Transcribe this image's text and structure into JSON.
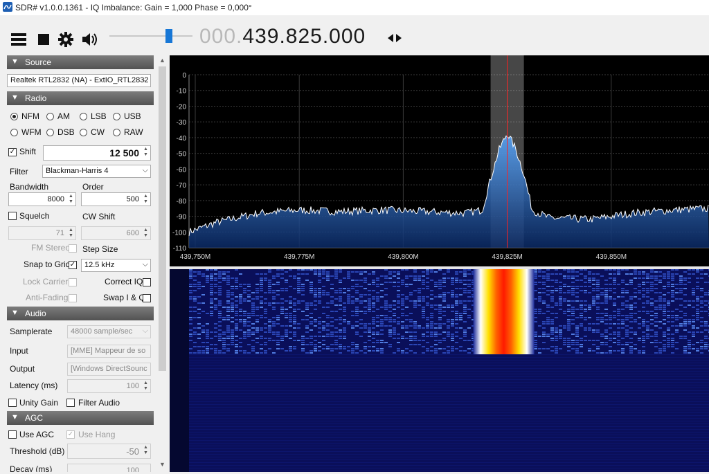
{
  "title": "SDR# v1.0.0.1361 - IQ Imbalance: Gain = 1,000 Phase = 0,000°",
  "toolbar": {
    "freq_lead": "000.",
    "freq_main": "439.825.000",
    "volume_level": 0.7
  },
  "source": {
    "header": "Source",
    "device": "Realtek RTL2832 (NA) - ExtIO_RTL2832"
  },
  "radio": {
    "header": "Radio",
    "modes_row1": [
      "NFM",
      "AM",
      "LSB",
      "USB"
    ],
    "modes_row2": [
      "WFM",
      "DSB",
      "CW",
      "RAW"
    ],
    "selected_mode": "NFM",
    "shift_label": "Shift",
    "shift_value": "12 500",
    "filter_label": "Filter",
    "filter_value": "Blackman-Harris 4",
    "bandwidth_label": "Bandwidth",
    "bandwidth_value": "8000",
    "order_label": "Order",
    "order_value": "500",
    "squelch_label": "Squelch",
    "squelch_value": "71",
    "cwshift_label": "CW Shift",
    "cwshift_value": "600",
    "fmstereo_label": "FM Stereo",
    "stepsize_label": "Step Size",
    "snap_label": "Snap to Grid",
    "snap_value": "12.5 kHz",
    "lockcarrier_label": "Lock Carrier",
    "correctiq_label": "Correct IQ",
    "antifading_label": "Anti-Fading",
    "swapiq_label": "Swap I & Q"
  },
  "audio": {
    "header": "Audio",
    "samplerate_label": "Samplerate",
    "samplerate_value": "48000 sample/sec",
    "input_label": "Input",
    "input_value": "[MME] Mappeur de so",
    "output_label": "Output",
    "output_value": "[Windows DirectSounc",
    "latency_label": "Latency (ms)",
    "latency_value": "100",
    "unitygain_label": "Unity Gain",
    "filteraudio_label": "Filter Audio"
  },
  "agc": {
    "header": "AGC",
    "useagc_label": "Use AGC",
    "usehang_label": "Use Hang",
    "threshold_label": "Threshold (dB)",
    "threshold_value": "-50",
    "decay_label": "Decay (ms)",
    "decay_value": "100"
  },
  "colors": {
    "accent": "#1777d6",
    "header_bar": "#5a5a5a",
    "spectrum_bg": "#000000",
    "spectrum_fill": "#1e5fa8",
    "center_line": "#ff2020",
    "waterfall_bg": "#0a0f5a"
  },
  "chart_data": {
    "type": "area",
    "y_ticks": [
      0,
      -10,
      -20,
      -30,
      -40,
      -50,
      -60,
      -70,
      -80,
      -90,
      -100,
      -110
    ],
    "ylim": [
      -110,
      0
    ],
    "x_tick_labels": [
      "439,750M",
      "439,775M",
      "439,800M",
      "439,825M",
      "439,850M"
    ],
    "x_tick_values": [
      439.75,
      439.775,
      439.8,
      439.825,
      439.85
    ],
    "xlim": [
      439.7485,
      439.8735
    ],
    "center_freq": 439.825,
    "filter_band": [
      439.821,
      439.829
    ],
    "grid": true,
    "profile": {
      "freqs": [
        439.7485,
        439.755,
        439.765,
        439.775,
        439.785,
        439.795,
        439.805,
        439.815,
        439.819,
        439.821,
        439.823,
        439.825,
        439.827,
        439.829,
        439.831,
        439.835,
        439.845,
        439.855,
        439.865,
        439.8735
      ],
      "levels_db": [
        -100,
        -94,
        -88,
        -86,
        -87,
        -86,
        -87,
        -88,
        -86,
        -66,
        -48,
        -37,
        -47,
        -63,
        -86,
        -91,
        -92,
        -88,
        -86,
        -85
      ]
    },
    "waterfall_signal_rows": 0.42
  }
}
